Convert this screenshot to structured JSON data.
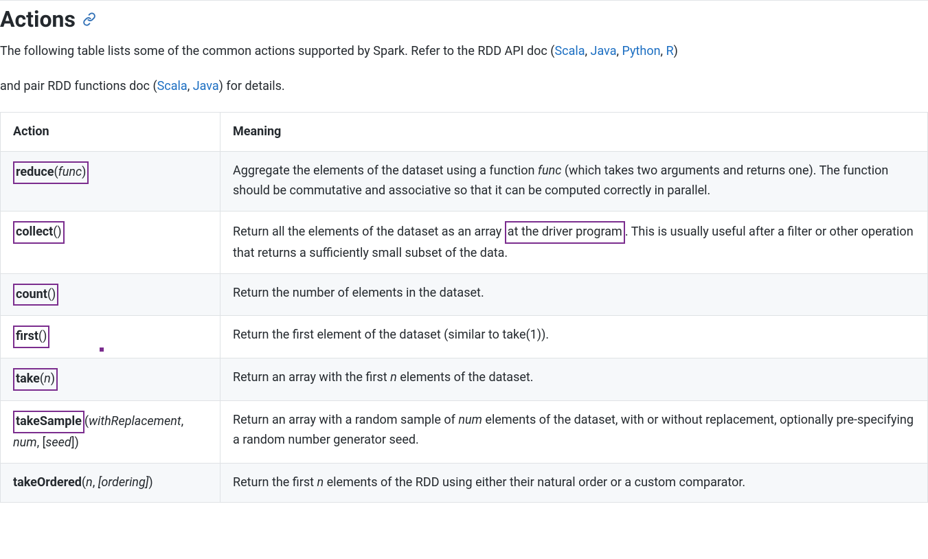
{
  "heading": "Actions",
  "intro": {
    "line1_before": "The following table lists some of the common actions supported by Spark. Refer to the RDD API doc (",
    "link_scala1": "Scala",
    "link_java1": "Java",
    "link_python": "Python",
    "link_r": "R",
    "line1_after": ")",
    "line2_before": "and pair RDD functions doc (",
    "link_scala2": "Scala",
    "link_java2": "Java",
    "line2_after": ") for details."
  },
  "table": {
    "header_action": "Action",
    "header_meaning": "Meaning",
    "rows": [
      {
        "action_bold": "reduce",
        "action_after_bold": "(",
        "action_ital": "func",
        "action_close": ")",
        "meaning_before": "Aggregate the elements of the dataset using a function ",
        "meaning_ital1": "func",
        "meaning_after": " (which takes two arguments and returns one). The function should be commutative and associative so that it can be computed correctly in parallel."
      },
      {
        "action_bold": "collect",
        "action_after_bold": "()",
        "meaning_before": "Return all the elements of the dataset as an array ",
        "meaning_hl": "at the driver program",
        "meaning_after": ". This is usually useful after a filter or other operation that returns a sufficiently small subset of the data."
      },
      {
        "action_bold": "count",
        "action_after_bold": "()",
        "meaning": "Return the number of elements in the dataset."
      },
      {
        "action_bold": "first",
        "action_after_bold": "()",
        "meaning": "Return the first element of the dataset (similar to take(1))."
      },
      {
        "action_bold": "take",
        "action_after_bold": "(",
        "action_ital": "n",
        "action_close": ")",
        "meaning_before": "Return an array with the first ",
        "meaning_ital1": "n",
        "meaning_after": " elements of the dataset."
      },
      {
        "action_bold": "takeSample",
        "action_after_bold": "(",
        "action_ital": "withReplacement",
        "action_mid": ", ",
        "action_ital2": "num",
        "action_mid2": ", [",
        "action_ital3": "seed",
        "action_close": "])",
        "meaning_before": "Return an array with a random sample of ",
        "meaning_ital1": "num",
        "meaning_after": " elements of the dataset, with or without replacement, optionally pre-specifying a random number generator seed."
      },
      {
        "action_bold_plain": "takeOrdered",
        "action_after_bold": "(",
        "action_ital": "n",
        "action_mid": ", ",
        "action_ital2_bracket_open": "[",
        "action_ital2": "ordering",
        "action_ital2_bracket_close": "]",
        "action_close": ")",
        "meaning_before": "Return the first ",
        "meaning_ital1": "n",
        "meaning_after": " elements of the RDD using either their natural order or a custom comparator."
      }
    ]
  }
}
